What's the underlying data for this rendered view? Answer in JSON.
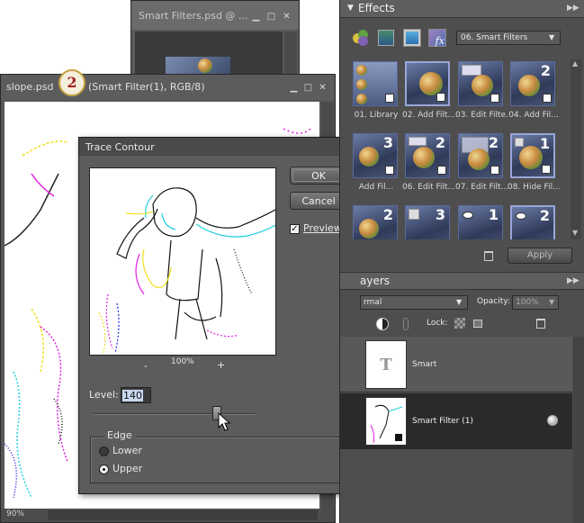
{
  "bg_window": {
    "title": "Smart Filters.psd @ ..."
  },
  "doc_window": {
    "title_file": "slope.psd",
    "badge": "2",
    "title_rest": "(Smart Filter(1), RGB/8)",
    "zoom": "90%"
  },
  "dialog": {
    "title": "Trace Contour",
    "ok_label": "OK",
    "cancel_label": "Cancel",
    "preview_label": "Preview",
    "preview_checked": true,
    "zoom_minus": "-",
    "zoom_value": "100%",
    "zoom_plus": "+",
    "level_label": "Level:",
    "level_value": "140",
    "edge_group_label": "Edge",
    "edge_options": [
      {
        "label": "Lower",
        "selected": false
      },
      {
        "label": "Upper",
        "selected": true
      }
    ]
  },
  "effects_panel": {
    "title": "Effects",
    "category": "06. Smart Filters",
    "thumbnails": [
      {
        "label": "01. Library",
        "num": ""
      },
      {
        "label": "02. Add Filt...",
        "num": ""
      },
      {
        "label": "03. Edit Filte...",
        "num": ""
      },
      {
        "label": "04. Add Fil...",
        "num": "2"
      },
      {
        "label": "Add Fil...",
        "num": "3"
      },
      {
        "label": "06. Edit Filt...",
        "num": "2"
      },
      {
        "label": "07. Edit Filt...",
        "num": "2"
      },
      {
        "label": "08. Hide Fil...",
        "num": "1"
      },
      {
        "label": "",
        "num": "2"
      },
      {
        "label": "",
        "num": "3"
      },
      {
        "label": "",
        "num": "1"
      },
      {
        "label": "",
        "num": "2"
      }
    ],
    "apply_label": "Apply"
  },
  "layers_panel": {
    "title": "ayers",
    "blend_mode": "rmal",
    "opacity_label": "Opacity:",
    "opacity_value": "100%",
    "lock_label": "Lock:",
    "layers": [
      {
        "name": "Smart",
        "thumb_glyph": "T"
      },
      {
        "name": "Smart Filter (1)",
        "thumb_glyph": ""
      }
    ]
  }
}
